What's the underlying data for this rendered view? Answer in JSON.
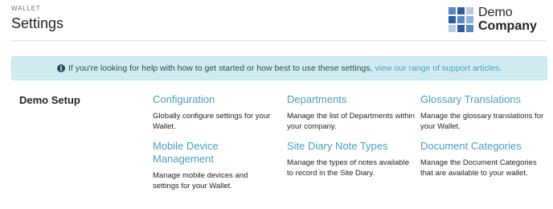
{
  "header": {
    "eyebrow": "WALLET",
    "title": "Settings"
  },
  "logo": {
    "line1": "Demo",
    "line2": "Company",
    "grid_colors": [
      "#5b86c6",
      "#2f5d9f",
      "#b7c8e3",
      "#2f5d9f",
      "#5b86c6",
      "#8fb0db",
      "#b7c8e3",
      "#2f5d9f",
      "#5b86c6"
    ]
  },
  "alert": {
    "icon": "info-icon",
    "text": "If you're looking for help with how to get started or how best to use these settings,",
    "link_text": "view our range of support articles",
    "suffix": "."
  },
  "section": {
    "label": "Demo Setup"
  },
  "cards": [
    {
      "title": "Configuration",
      "description": "Globally configure settings for your Wallet."
    },
    {
      "title": "Departments",
      "description": "Manage the list of Departments within your company."
    },
    {
      "title": "Glossary Translations",
      "description": "Manage the glossary translations for your Wallet."
    },
    {
      "title": "Mobile Device Management",
      "description": "Manage mobile devices and settings for your Wallet."
    },
    {
      "title": "Site Diary Note Types",
      "description": "Manage the types of notes available to record in the Site Diary."
    },
    {
      "title": "Document Categories",
      "description": "Manage the Document Categories that are available to your wallet."
    }
  ],
  "colors": {
    "link": "#4a9ec0",
    "alert_bg": "#d1ecf1"
  }
}
